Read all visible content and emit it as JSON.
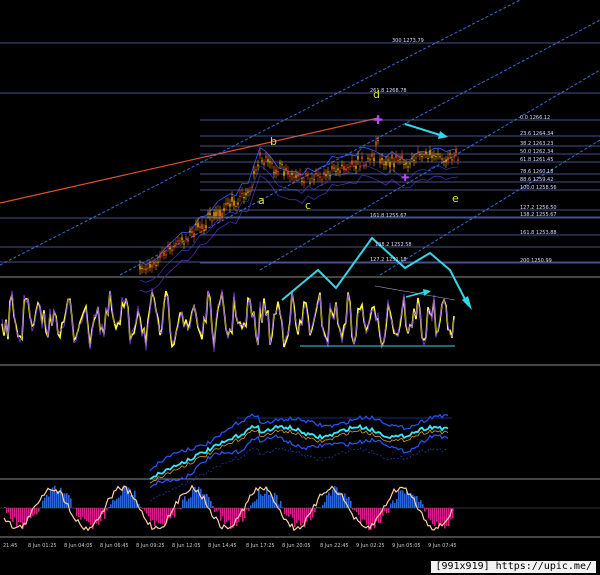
{
  "chart_data": {
    "type": "line",
    "price_panel": {
      "wave_labels": [
        "a",
        "b",
        "c",
        "d",
        "e"
      ],
      "fib_levels": [
        {
          "label": "0.0 1266.12",
          "side": "right"
        },
        {
          "label": "23.6 1264.34",
          "side": "right"
        },
        {
          "label": "38.2 1263.23",
          "side": "right"
        },
        {
          "label": "50.0 1262.34",
          "side": "right"
        },
        {
          "label": "61.8 1261.45",
          "side": "right"
        },
        {
          "label": "78.6 1260.18",
          "side": "right"
        },
        {
          "label": "88.6 1259.42",
          "side": "right"
        },
        {
          "label": "100.0 1258.56",
          "side": "right"
        },
        {
          "label": "127.2 1256.50",
          "side": "right"
        },
        {
          "label": "138.2 1255.67",
          "side": "right"
        },
        {
          "label": "161.8 1253.88",
          "side": "right"
        },
        {
          "label": "200 1250.99",
          "side": "right"
        },
        {
          "label": "300 1273.79",
          "side": "top"
        },
        {
          "label": "261.8 1268.78",
          "side": "mid"
        },
        {
          "label": "161.8 1255.67",
          "side": "low"
        },
        {
          "label": "138.2 1252.58",
          "side": "low"
        },
        {
          "label": "127.2 1251.18",
          "side": "low"
        }
      ]
    },
    "x_tick_labels": [
      "21:45",
      "8 Jun 01:25",
      "8 Jun 04:05",
      "8 Jun 06:45",
      "8 Jun 09:25",
      "8 Jun 12:05",
      "8 Jun 14:45",
      "8 Jun 17:25",
      "8 Jun 20:05",
      "8 Jun 22:45",
      "9 Jun 02:25",
      "9 Jun 05:05",
      "9 Jun 07:45"
    ]
  },
  "watermark": "[991x919] https://upic.me/",
  "colors": {
    "background": "#000000",
    "bull_candle": "#ffb300",
    "bear_candle": "#ff5722",
    "oscillator": "#ffff33",
    "arrows": "#35d6e6",
    "fib_lines": "#6f7fd8",
    "trend_red": "#e0502b",
    "channel_blue": "#2f6fd8"
  }
}
